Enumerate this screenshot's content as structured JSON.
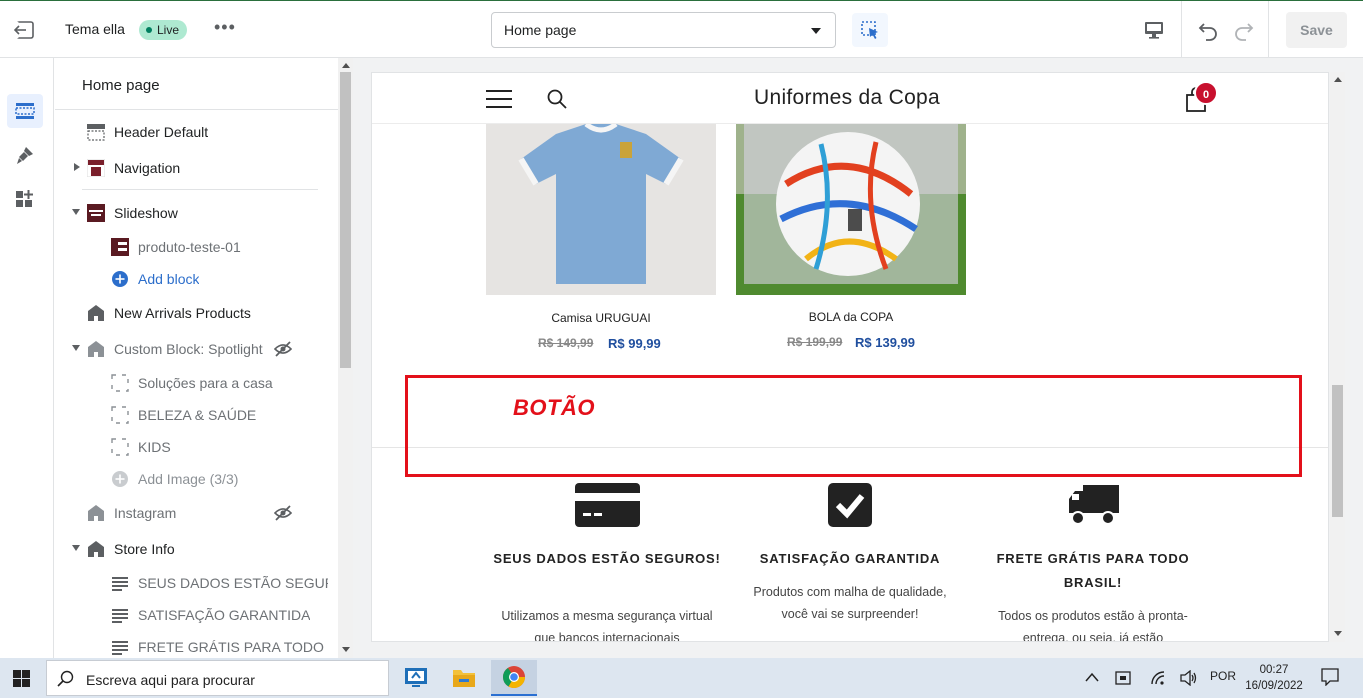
{
  "topbar": {
    "theme_name": "Tema ella",
    "live_label": "Live",
    "more_label": "•••",
    "page_select": "Home page",
    "save_label": "Save"
  },
  "sidebar": {
    "title": "Home page",
    "items": [
      {
        "label": "Header Default"
      },
      {
        "label": "Navigation"
      },
      {
        "label": "Slideshow"
      },
      {
        "label": "produto-teste-01"
      },
      {
        "label": "Add block"
      },
      {
        "label": "New Arrivals Products"
      },
      {
        "label": "Custom Block: Spotlight"
      },
      {
        "label": "Soluções para a casa"
      },
      {
        "label": "BELEZA & SAÚDE"
      },
      {
        "label": "KIDS"
      },
      {
        "label": "Add Image (3/3)"
      },
      {
        "label": "Instagram"
      },
      {
        "label": "Store Info"
      },
      {
        "label": "SEUS DADOS ESTÃO SEGUR..."
      },
      {
        "label": "SATISFAÇÃO GARANTIDA"
      },
      {
        "label": "FRETE GRÁTIS PARA TODO B..."
      }
    ]
  },
  "preview": {
    "store_name": "Uniformes da Copa",
    "cart_count": "0",
    "products": [
      {
        "name": "Camisa URUGUAI",
        "old_price": "R$ 149,99",
        "new_price": "R$ 99,99"
      },
      {
        "name": "BOLA da COPA",
        "old_price": "R$ 199,99",
        "new_price": "R$ 139,99"
      }
    ],
    "annotation": "BOTÃO",
    "features": [
      {
        "title": "SEUS DADOS ESTÃO SEGUROS!",
        "desc": "Utilizamos a mesma segurança virtual que bancos internacionais"
      },
      {
        "title": "SATISFAÇÃO GARANTIDA",
        "desc": "Produtos com malha de qualidade, você vai se surpreender!"
      },
      {
        "title": "FRETE GRÁTIS PARA TODO BRASIL!",
        "desc": "Todos os produtos estão à pronta-entrega, ou seja, já estão"
      }
    ]
  },
  "taskbar": {
    "search_placeholder": "Escreva aqui para procurar",
    "language": "POR",
    "time": "00:27",
    "date": "16/09/2022"
  },
  "colors": {
    "accent": "#2c6ecb",
    "live_badge": "#aee9d1",
    "annotation": "#e3101a",
    "price": "#1f4e9e",
    "cart_badge": "#c8102e"
  }
}
